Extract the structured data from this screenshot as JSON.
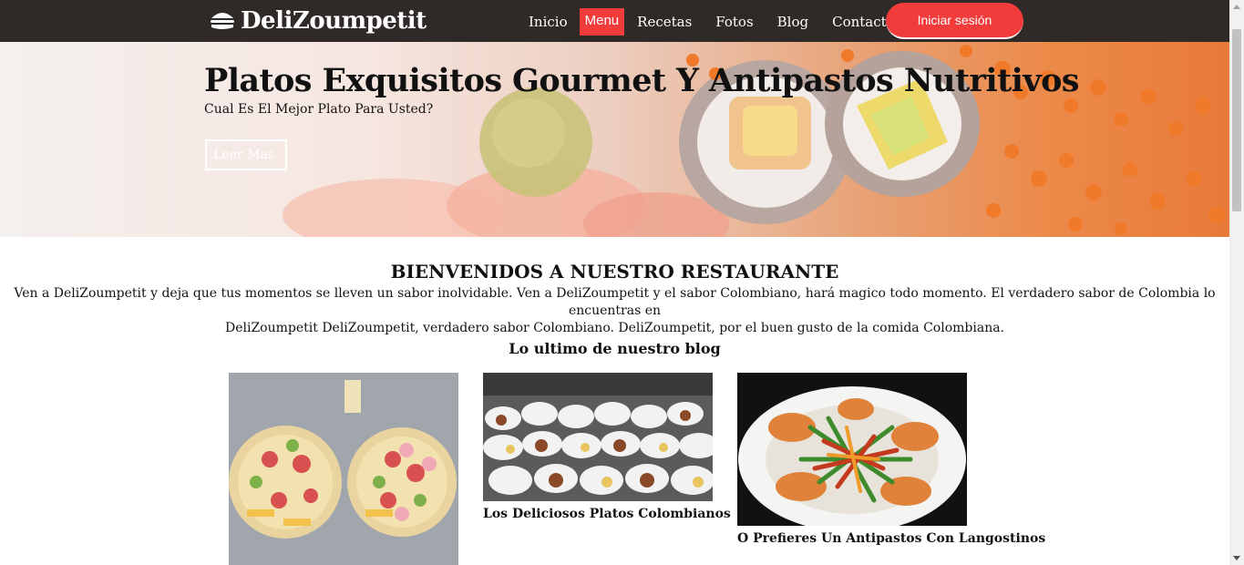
{
  "header": {
    "logo_text": "DeliZoumpetit",
    "nav": [
      {
        "label": "Inicio"
      },
      {
        "label": "Menu"
      },
      {
        "label": "Recetas"
      },
      {
        "label": "Fotos"
      },
      {
        "label": "Blog"
      },
      {
        "label": "Contacto"
      }
    ],
    "login_label": "Iniciar sesión",
    "accent_color": "#f23b3b",
    "bar_color": "#2f2a28"
  },
  "hero": {
    "title": "Platos Exquisitos Gourmet Y Antipastos Nutritivos",
    "subtitle": "Cual Es El Mejor Plato Para Usted?",
    "button_label": "Leer Mas"
  },
  "welcome": {
    "title": "BIENVENIDOS A NUESTRO RESTAURANTE",
    "line1": "Ven a DeliZoumpetit y deja que tus momentos se lleven un sabor inolvidable. Ven a DeliZoumpetit y el sabor Colombiano, hará magico todo momento. El verdadero sabor de Colombia lo encuentras en",
    "line2": "DeliZoumpetit DeliZoumpetit, verdadero sabor Colombiano. DeliZoumpetit, por el buen gusto de la comida Colombiana."
  },
  "blog": {
    "heading": "Lo ultimo de nuestro blog",
    "posts": [
      {
        "caption": ""
      },
      {
        "caption": "Los Deliciosos Platos Colombianos"
      },
      {
        "caption": "O Prefieres Un Antipastos Con Langostinos"
      }
    ]
  }
}
